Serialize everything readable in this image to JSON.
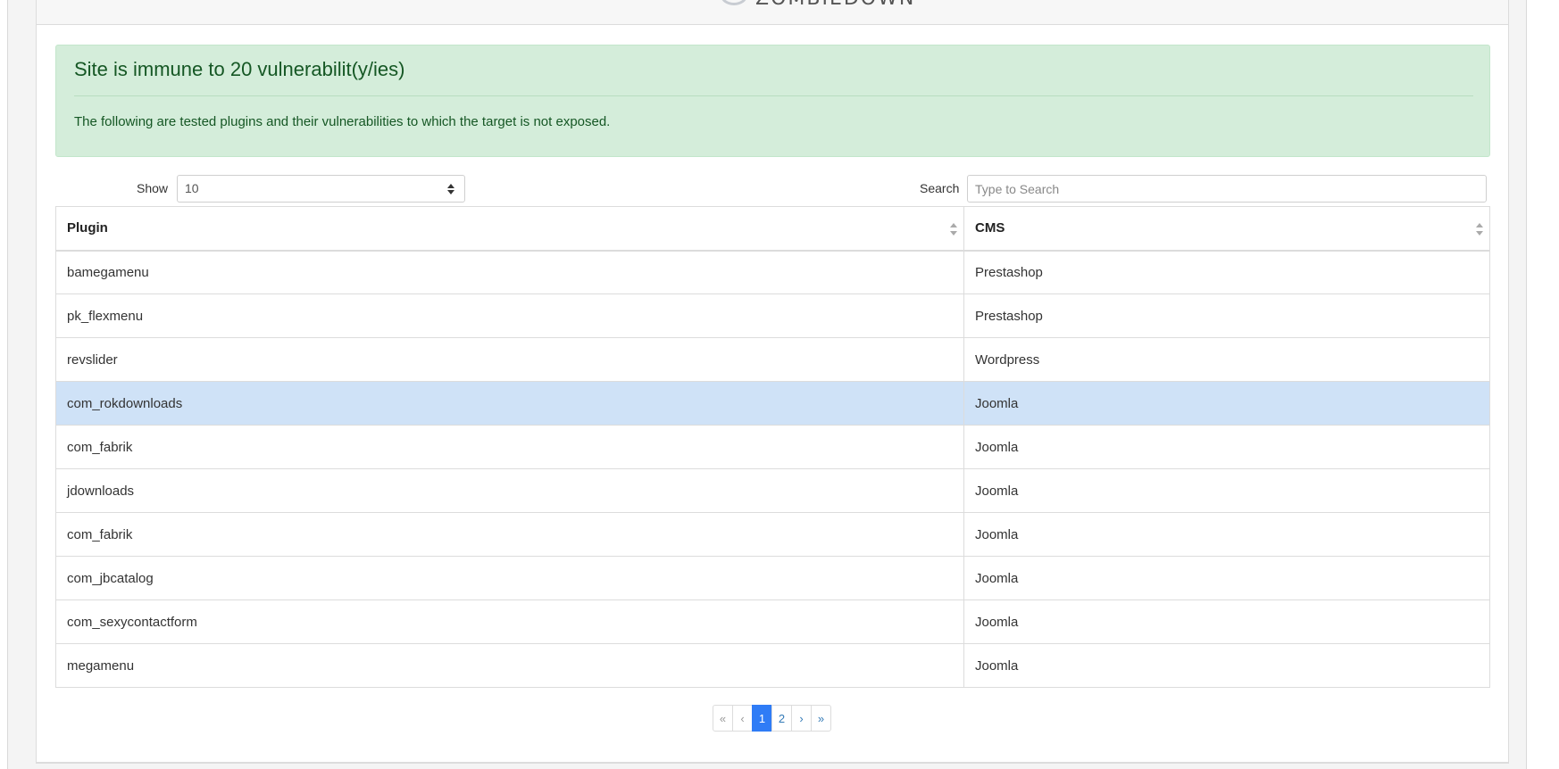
{
  "header": {
    "logo_text": "ZOMBIEDOWN"
  },
  "alert": {
    "title": "Site is immune to 20 vulnerabilit(y/ies)",
    "description": "The following are tested plugins and their vulnerabilities to which the target is not exposed.",
    "color": "#d4edda"
  },
  "controls": {
    "show_label": "Show",
    "show_value": "10",
    "search_label": "Search",
    "search_placeholder": "Type to Search"
  },
  "table": {
    "columns": [
      "Plugin",
      "CMS"
    ],
    "rows": [
      {
        "plugin": "bamegamenu",
        "cms": "Prestashop",
        "highlighted": false
      },
      {
        "plugin": "pk_flexmenu",
        "cms": "Prestashop",
        "highlighted": false
      },
      {
        "plugin": "revslider",
        "cms": "Wordpress",
        "highlighted": false
      },
      {
        "plugin": "com_rokdownloads",
        "cms": "Joomla",
        "highlighted": true
      },
      {
        "plugin": "com_fabrik",
        "cms": "Joomla",
        "highlighted": false
      },
      {
        "plugin": "jdownloads",
        "cms": "Joomla",
        "highlighted": false
      },
      {
        "plugin": "com_fabrik",
        "cms": "Joomla",
        "highlighted": false
      },
      {
        "plugin": "com_jbcatalog",
        "cms": "Joomla",
        "highlighted": false
      },
      {
        "plugin": "com_sexycontactform",
        "cms": "Joomla",
        "highlighted": false
      },
      {
        "plugin": "megamenu",
        "cms": "Joomla",
        "highlighted": false
      }
    ],
    "highlight_color": "#cfe2f7"
  },
  "pagination": {
    "first": "«",
    "prev": "‹",
    "pages": [
      "1",
      "2"
    ],
    "current_page": "1",
    "next": "›",
    "last": "»",
    "active_color": "#2f7cf6"
  }
}
